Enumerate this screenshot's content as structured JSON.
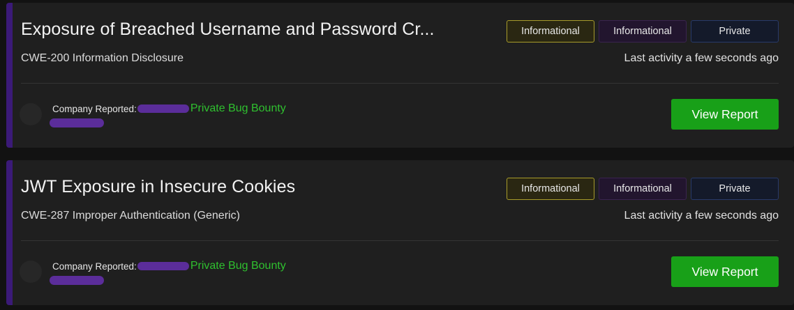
{
  "reports": [
    {
      "title": "Exposure of Breached Username and Password Cr...",
      "weakness": "CWE-200 Information Disclosure",
      "badges": {
        "severity": "Informational",
        "state": "Informational",
        "visibility": "Private"
      },
      "last_activity": "Last activity a few seconds ago",
      "company_label": "Company Reported:",
      "program_type": "Private Bug Bounty",
      "action_label": "View Report"
    },
    {
      "title": "JWT Exposure in Insecure Cookies",
      "weakness": "CWE-287 Improper Authentication (Generic)",
      "badges": {
        "severity": "Informational",
        "state": "Informational",
        "visibility": "Private"
      },
      "last_activity": "Last activity a few seconds ago",
      "company_label": "Company Reported:",
      "program_type": "Private Bug Bounty",
      "action_label": "View Report"
    }
  ],
  "colors": {
    "accent": "#3b1a78",
    "program_text": "#2fc02f",
    "primary_button": "#18a018",
    "redaction": "#5b2d9a"
  }
}
